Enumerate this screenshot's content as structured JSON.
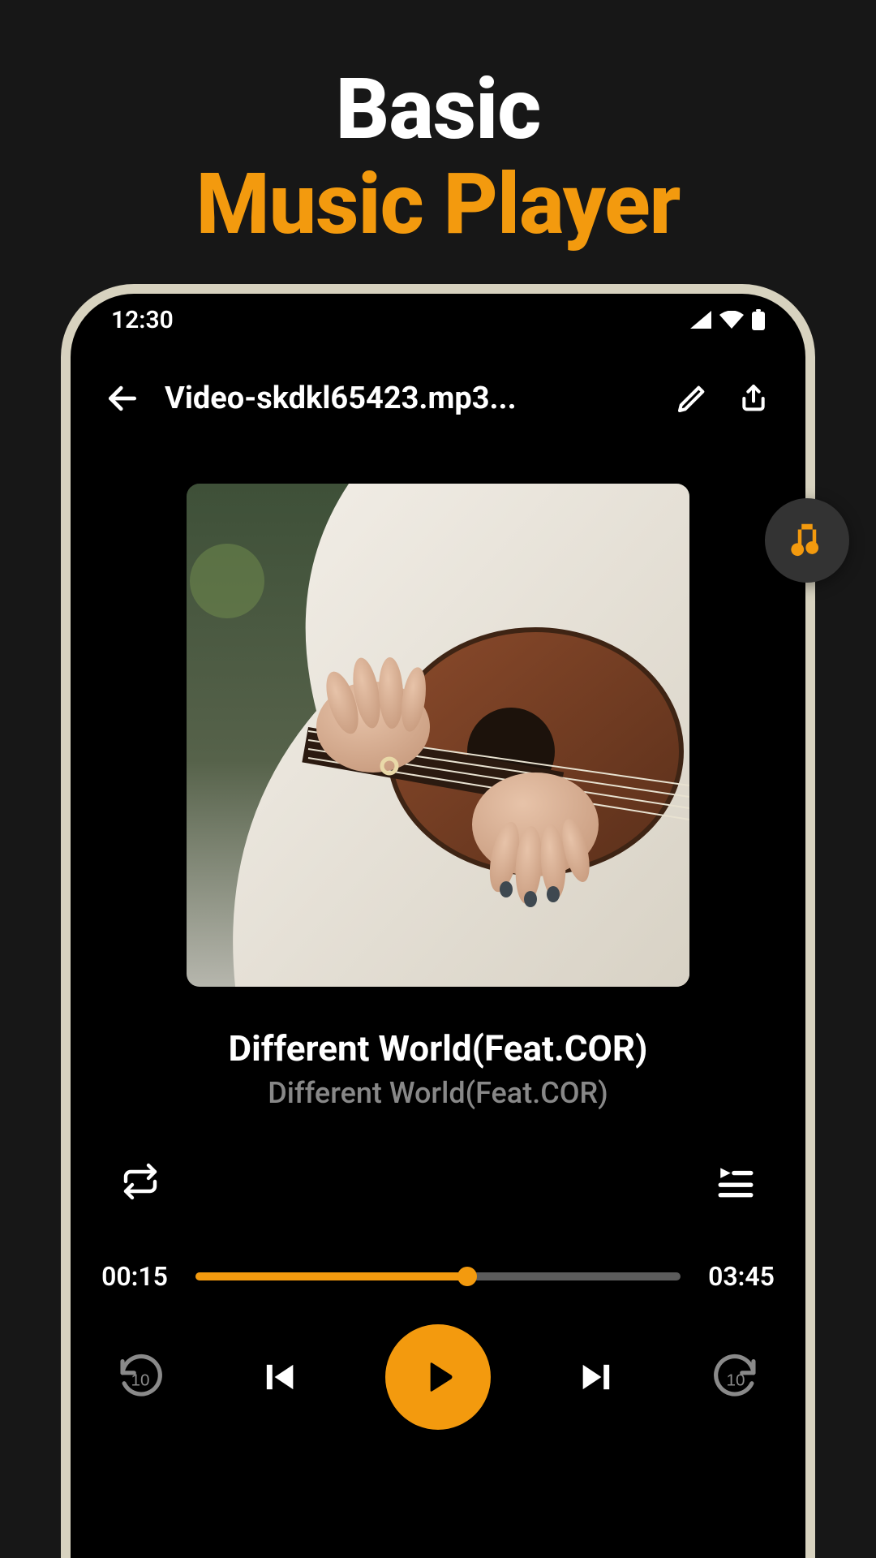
{
  "promo": {
    "line1": "Basic",
    "line2": "Music Player"
  },
  "statusbar": {
    "time": "12:30"
  },
  "appbar": {
    "file_title": "Video-skdkl65423.mp3..."
  },
  "track": {
    "title": "Different World(Feat.COR)",
    "subtitle": "Different World(Feat.COR)"
  },
  "progress": {
    "elapsed": "00:15",
    "total": "03:45",
    "percent": 56
  },
  "colors": {
    "accent": "#f39a0e",
    "bg": "#171717",
    "phone_border": "#d7d2bf"
  },
  "icons": {
    "back": "arrow-left-icon",
    "edit": "pencil-icon",
    "share": "share-icon",
    "repeat": "repeat-icon",
    "queue": "playlist-icon",
    "rewind10": "rewind-10-icon",
    "prev": "skip-previous-icon",
    "play": "play-icon",
    "next": "skip-next-icon",
    "forward10": "forward-10-icon",
    "music": "music-note-icon",
    "signal": "cellular-icon",
    "wifi": "wifi-icon",
    "battery": "battery-icon"
  }
}
